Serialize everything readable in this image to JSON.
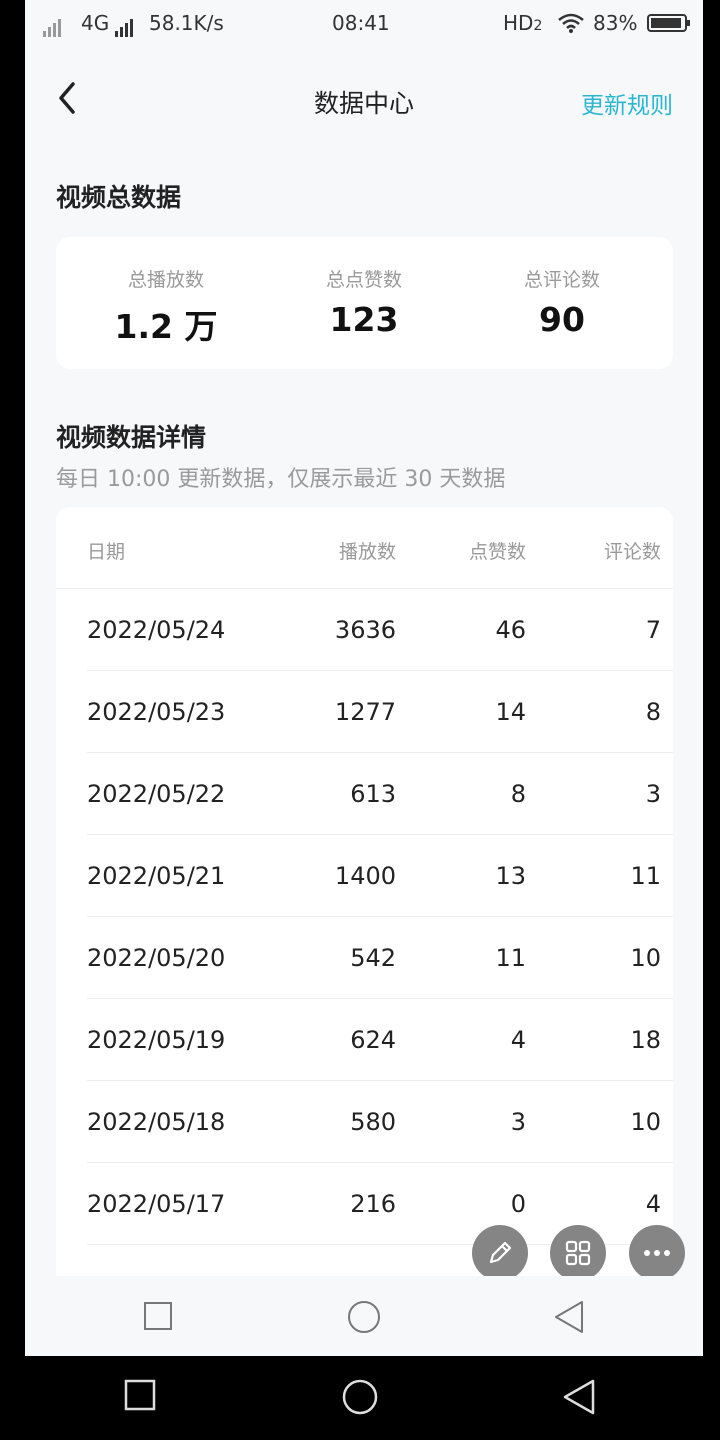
{
  "status_bar": {
    "network": "4G",
    "speed": "58.1K/s",
    "time": "08:41",
    "hd": "HD",
    "hd_sub": "2",
    "battery": "83%"
  },
  "nav": {
    "title": "数据中心",
    "action_label": "更新规则"
  },
  "summary": {
    "title": "视频总数据",
    "stats": [
      {
        "label": "总播放数",
        "value": "1.2 万"
      },
      {
        "label": "总点赞数",
        "value": "123"
      },
      {
        "label": "总评论数",
        "value": "90"
      }
    ]
  },
  "detail": {
    "title": "视频数据详情",
    "subtitle": "每日 10:00 更新数据，仅展示最近 30 天数据",
    "columns": [
      "日期",
      "播放数",
      "点赞数",
      "评论数"
    ],
    "rows": [
      [
        "2022/05/24",
        "3636",
        "46",
        "7"
      ],
      [
        "2022/05/23",
        "1277",
        "14",
        "8"
      ],
      [
        "2022/05/22",
        "613",
        "8",
        "3"
      ],
      [
        "2022/05/21",
        "1400",
        "13",
        "11"
      ],
      [
        "2022/05/20",
        "542",
        "11",
        "10"
      ],
      [
        "2022/05/19",
        "624",
        "4",
        "18"
      ],
      [
        "2022/05/18",
        "580",
        "3",
        "10"
      ],
      [
        "2022/05/17",
        "216",
        "0",
        "4"
      ]
    ]
  },
  "colors": {
    "accent": "#2ab7d4",
    "background": "#f7f8fa",
    "card": "#ffffff",
    "fab": "#858585"
  },
  "icons": {
    "back": "chevron-left-icon",
    "fab": [
      "pencil-icon",
      "grid-icon",
      "more-icon"
    ],
    "inner_nav": [
      "square-icon",
      "circle-icon",
      "triangle-back-icon"
    ],
    "system_nav": [
      "square-icon",
      "circle-icon",
      "triangle-back-icon"
    ]
  }
}
